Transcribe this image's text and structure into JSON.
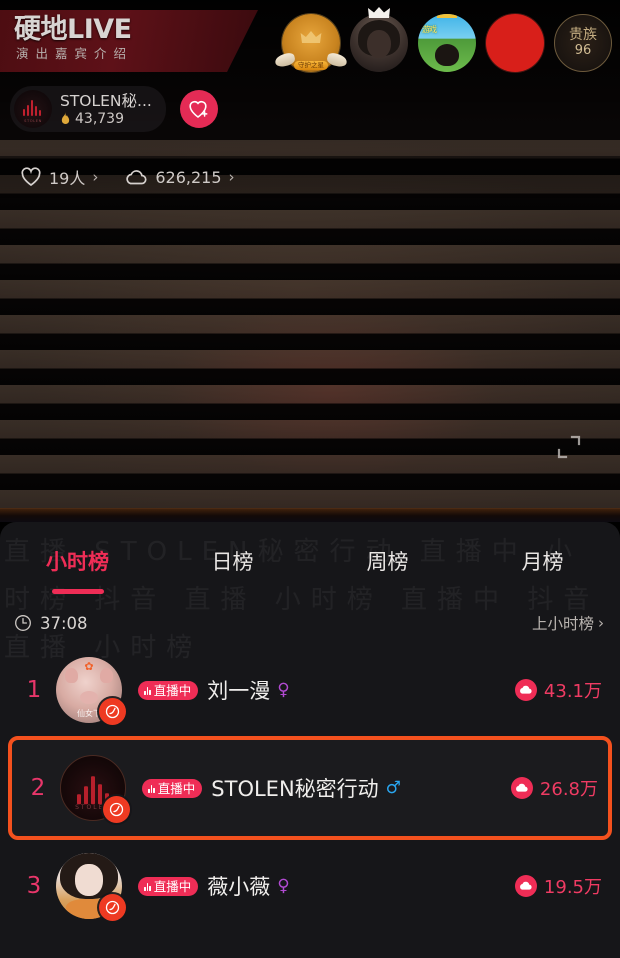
{
  "stage": {
    "show_banner": {
      "title": "硬地LIVE",
      "subtitle": "演出嘉宾介绍"
    },
    "streamer": {
      "name": "STOLEN秘...",
      "heat": "43,739",
      "avatar_mini_label": "STOLEN",
      "follow_icon": "heart-plus-icon"
    },
    "top_avatars": [
      {
        "name": "guardian-badge",
        "tag": "守护之星",
        "icon": "crown-icon"
      },
      {
        "name": "viewer-avatar-photo",
        "icon": "crown-icon"
      },
      {
        "name": "viewer-avatar-game",
        "label": "游戏"
      },
      {
        "name": "viewer-avatar-red"
      },
      {
        "name": "noble-badge",
        "title": "贵族",
        "level": "96"
      }
    ],
    "stats": {
      "likes_icon": "heart-icon",
      "likes": "19人",
      "popularity_icon": "cloud-icon",
      "popularity": "626,215",
      "chevron": "›"
    },
    "fullscreen_icon": "fullscreen-expand-icon"
  },
  "rank_panel": {
    "watermark": "直播 STOLEN秘密行动 直播中 小时榜 抖音 直播 小时榜 直播中 抖音 直播 小时榜",
    "tabs": [
      {
        "label": "小时榜",
        "active": true
      },
      {
        "label": "日榜",
        "active": false
      },
      {
        "label": "周榜",
        "active": false
      },
      {
        "label": "月榜",
        "active": false
      }
    ],
    "timer": {
      "icon": "clock-icon",
      "value": "37:08",
      "prev_link": "上小时榜",
      "chevron": "›"
    },
    "rows": [
      {
        "rank": "1",
        "avatar": "pig-avatar",
        "avatar_nick": "仙女下",
        "live_badge": "直播中",
        "name": "刘一漫",
        "gender": "female",
        "gender_glyph": "♀",
        "score": "43.1万",
        "score_icon": "cloud-icon",
        "highlight": false
      },
      {
        "rank": "2",
        "avatar": "stolen-avatar",
        "avatar_nick": "STOLEN",
        "live_badge": "直播中",
        "name": "STOLEN秘密行动",
        "gender": "male",
        "gender_glyph": "♂",
        "score": "26.8万",
        "score_icon": "cloud-icon",
        "highlight": true
      },
      {
        "rank": "3",
        "avatar": "girl-avatar",
        "avatar_nick": "",
        "live_badge": "直播中",
        "name": "薇小薇",
        "gender": "female",
        "gender_glyph": "♀",
        "score": "19.5万",
        "score_icon": "cloud-icon",
        "highlight": false
      }
    ]
  },
  "colors": {
    "accent_pink": "#ef2d56",
    "highlight_orange": "#f4511e",
    "panel_bg": "#161619",
    "male_blue": "#2aa6f0",
    "female_purple": "#b14ad1"
  }
}
